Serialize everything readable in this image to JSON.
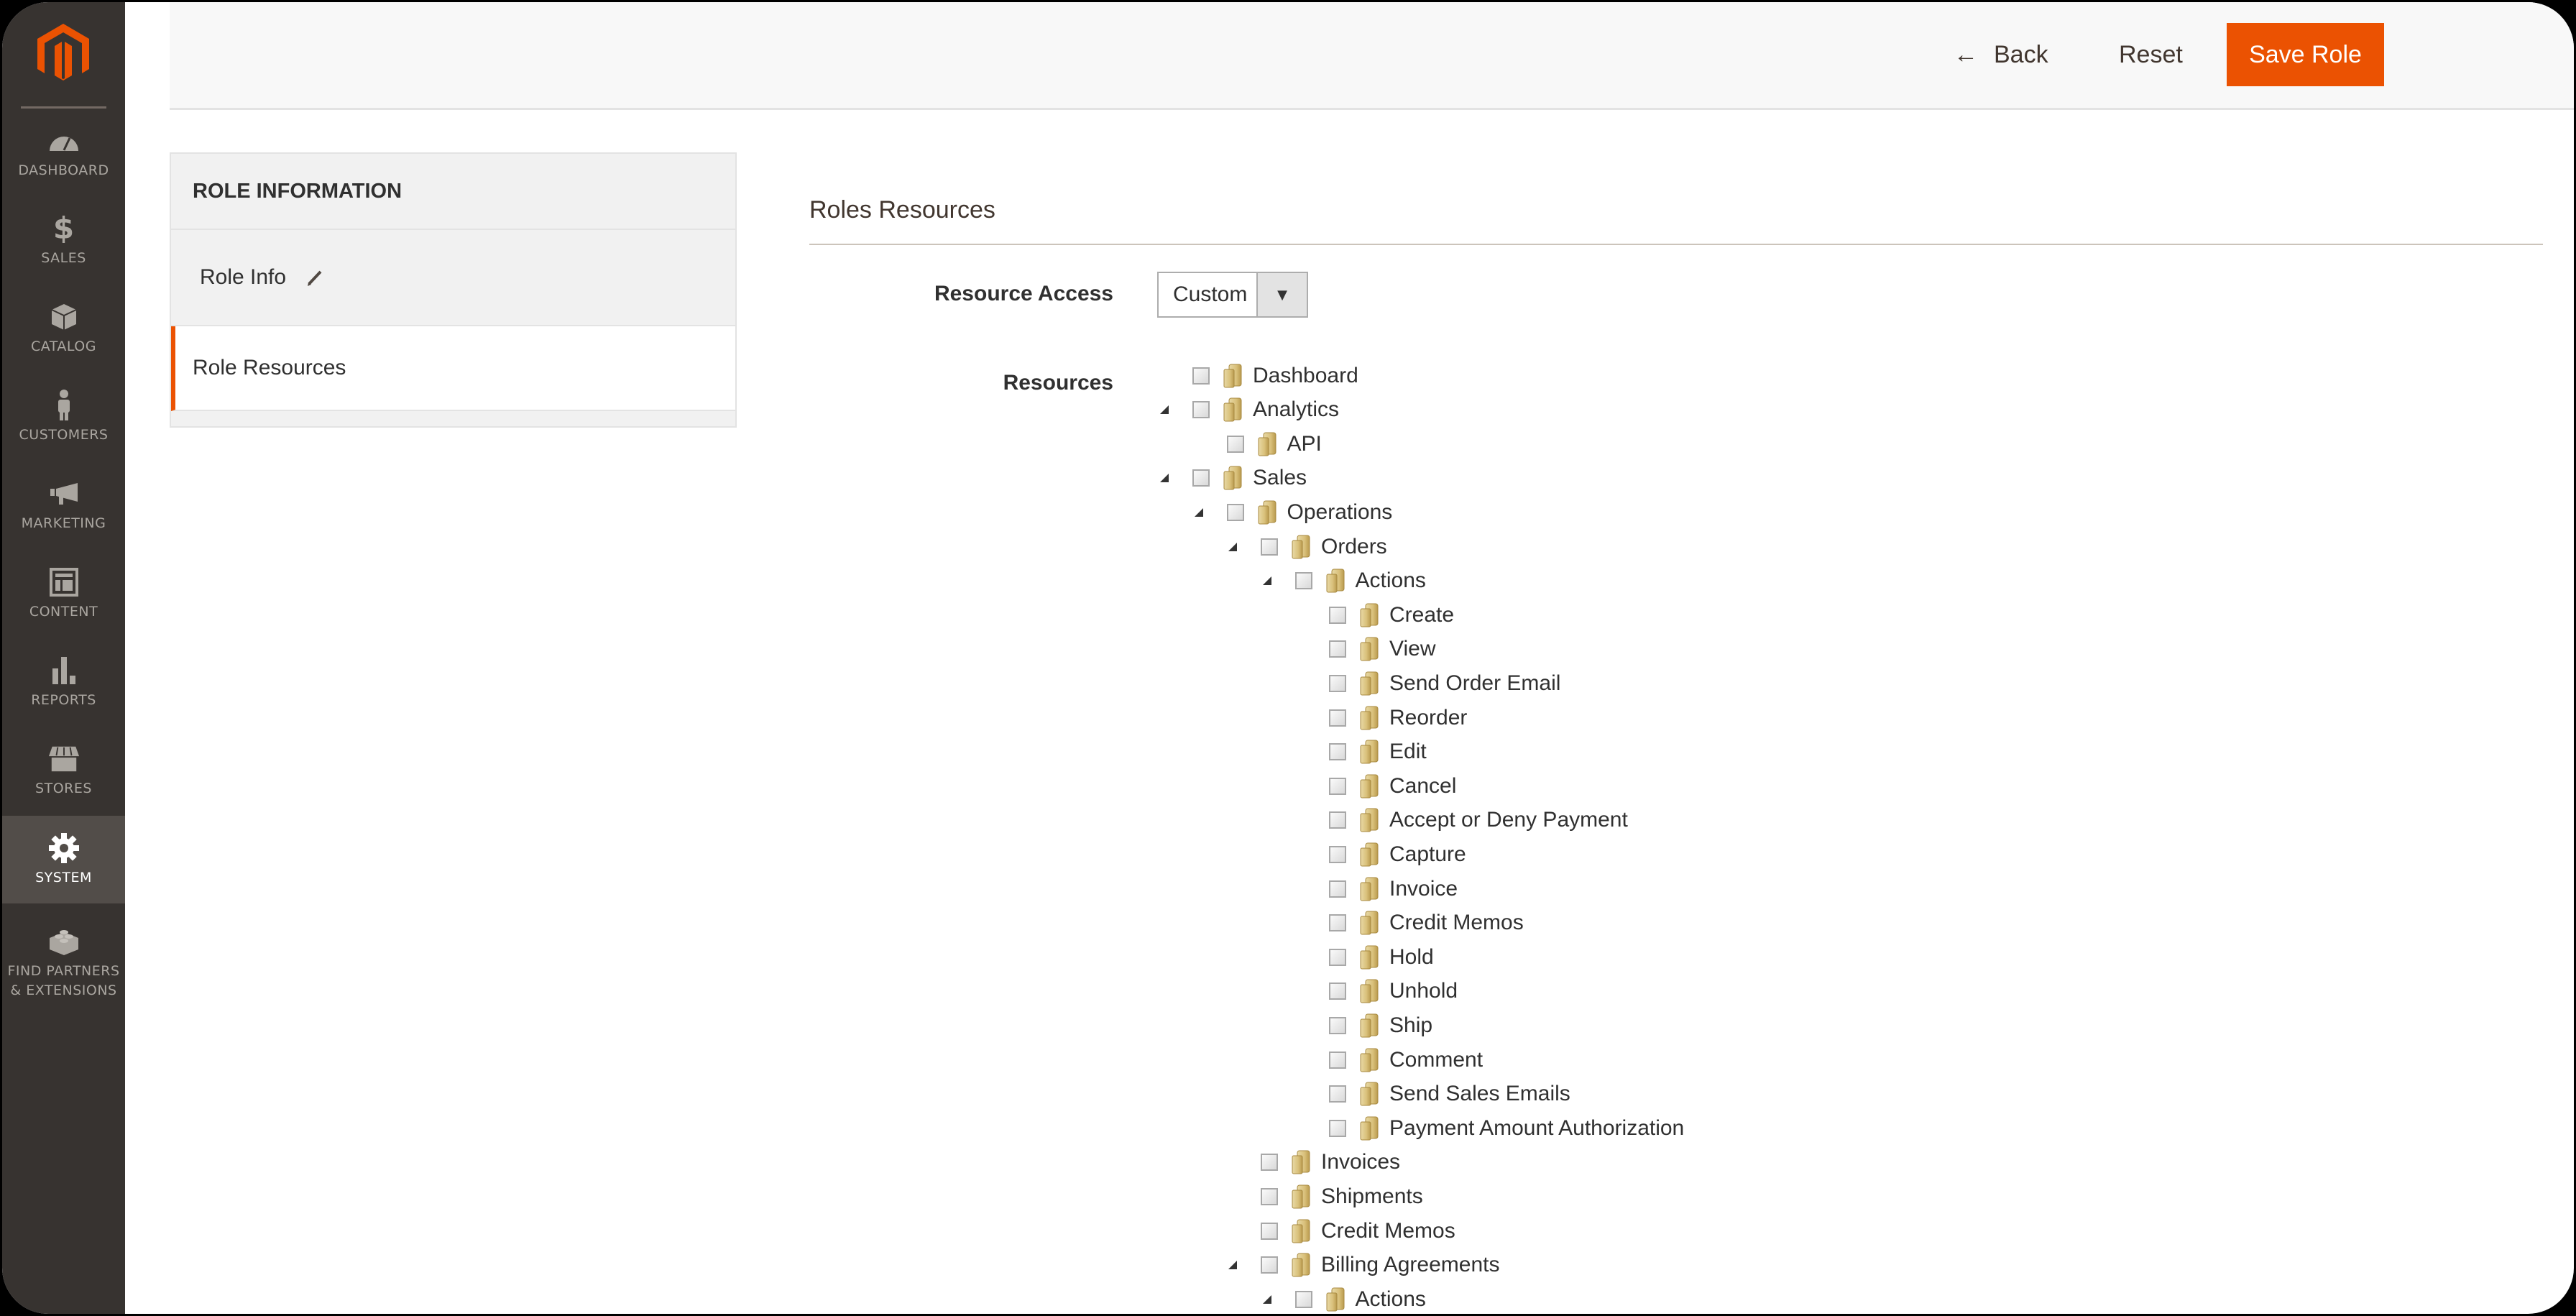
{
  "brand": {
    "accent": "#eb5202",
    "sidebar_bg": "#373330"
  },
  "sidebar": {
    "items": [
      {
        "label": "DASHBOARD",
        "icon": "dashboard-icon"
      },
      {
        "label": "SALES",
        "icon": "dollar-icon"
      },
      {
        "label": "CATALOG",
        "icon": "box-icon"
      },
      {
        "label": "CUSTOMERS",
        "icon": "person-icon"
      },
      {
        "label": "MARKETING",
        "icon": "megaphone-icon"
      },
      {
        "label": "CONTENT",
        "icon": "layout-icon"
      },
      {
        "label": "REPORTS",
        "icon": "bar-chart-icon"
      },
      {
        "label": "STORES",
        "icon": "storefront-icon"
      },
      {
        "label": "SYSTEM",
        "icon": "gear-icon",
        "active": true
      },
      {
        "label_line1": "FIND PARTNERS",
        "label_line2": "& EXTENSIONS",
        "icon": "lego-brick-icon"
      }
    ]
  },
  "header": {
    "back_label": "Back",
    "reset_label": "Reset",
    "save_label": "Save Role"
  },
  "tabs": {
    "title": "ROLE INFORMATION",
    "items": [
      {
        "label": "Role Info",
        "has_edit_icon": true
      },
      {
        "label": "Role Resources",
        "active": true
      }
    ]
  },
  "main": {
    "section_title": "Roles Resources",
    "resource_access": {
      "label": "Resource Access",
      "value": "Custom"
    },
    "resources_label": "Resources",
    "tree": [
      {
        "label": "Dashboard",
        "level": 0,
        "expanded": null,
        "checked": false
      },
      {
        "label": "Analytics",
        "level": 0,
        "expanded": true,
        "checked": false
      },
      {
        "label": "API",
        "level": 1,
        "expanded": null,
        "checked": false
      },
      {
        "label": "Sales",
        "level": 0,
        "expanded": true,
        "checked": false
      },
      {
        "label": "Operations",
        "level": 1,
        "expanded": true,
        "checked": false
      },
      {
        "label": "Orders",
        "level": 2,
        "expanded": true,
        "checked": false
      },
      {
        "label": "Actions",
        "level": 3,
        "expanded": true,
        "checked": false
      },
      {
        "label": "Create",
        "level": 4,
        "expanded": null,
        "checked": false
      },
      {
        "label": "View",
        "level": 4,
        "expanded": null,
        "checked": false
      },
      {
        "label": "Send Order Email",
        "level": 4,
        "expanded": null,
        "checked": false
      },
      {
        "label": "Reorder",
        "level": 4,
        "expanded": null,
        "checked": false
      },
      {
        "label": "Edit",
        "level": 4,
        "expanded": null,
        "checked": false
      },
      {
        "label": "Cancel",
        "level": 4,
        "expanded": null,
        "checked": false
      },
      {
        "label": "Accept or Deny Payment",
        "level": 4,
        "expanded": null,
        "checked": false
      },
      {
        "label": "Capture",
        "level": 4,
        "expanded": null,
        "checked": false
      },
      {
        "label": "Invoice",
        "level": 4,
        "expanded": null,
        "checked": false
      },
      {
        "label": "Credit Memos",
        "level": 4,
        "expanded": null,
        "checked": false
      },
      {
        "label": "Hold",
        "level": 4,
        "expanded": null,
        "checked": false
      },
      {
        "label": "Unhold",
        "level": 4,
        "expanded": null,
        "checked": false
      },
      {
        "label": "Ship",
        "level": 4,
        "expanded": null,
        "checked": false
      },
      {
        "label": "Comment",
        "level": 4,
        "expanded": null,
        "checked": false
      },
      {
        "label": "Send Sales Emails",
        "level": 4,
        "expanded": null,
        "checked": false
      },
      {
        "label": "Payment Amount Authorization",
        "level": 4,
        "expanded": null,
        "checked": false
      },
      {
        "label": "Invoices",
        "level": 2,
        "expanded": null,
        "checked": false
      },
      {
        "label": "Shipments",
        "level": 2,
        "expanded": null,
        "checked": false
      },
      {
        "label": "Credit Memos",
        "level": 2,
        "expanded": null,
        "checked": false
      },
      {
        "label": "Billing Agreements",
        "level": 2,
        "expanded": true,
        "checked": false
      },
      {
        "label": "Actions",
        "level": 3,
        "expanded": true,
        "checked": false
      }
    ]
  }
}
